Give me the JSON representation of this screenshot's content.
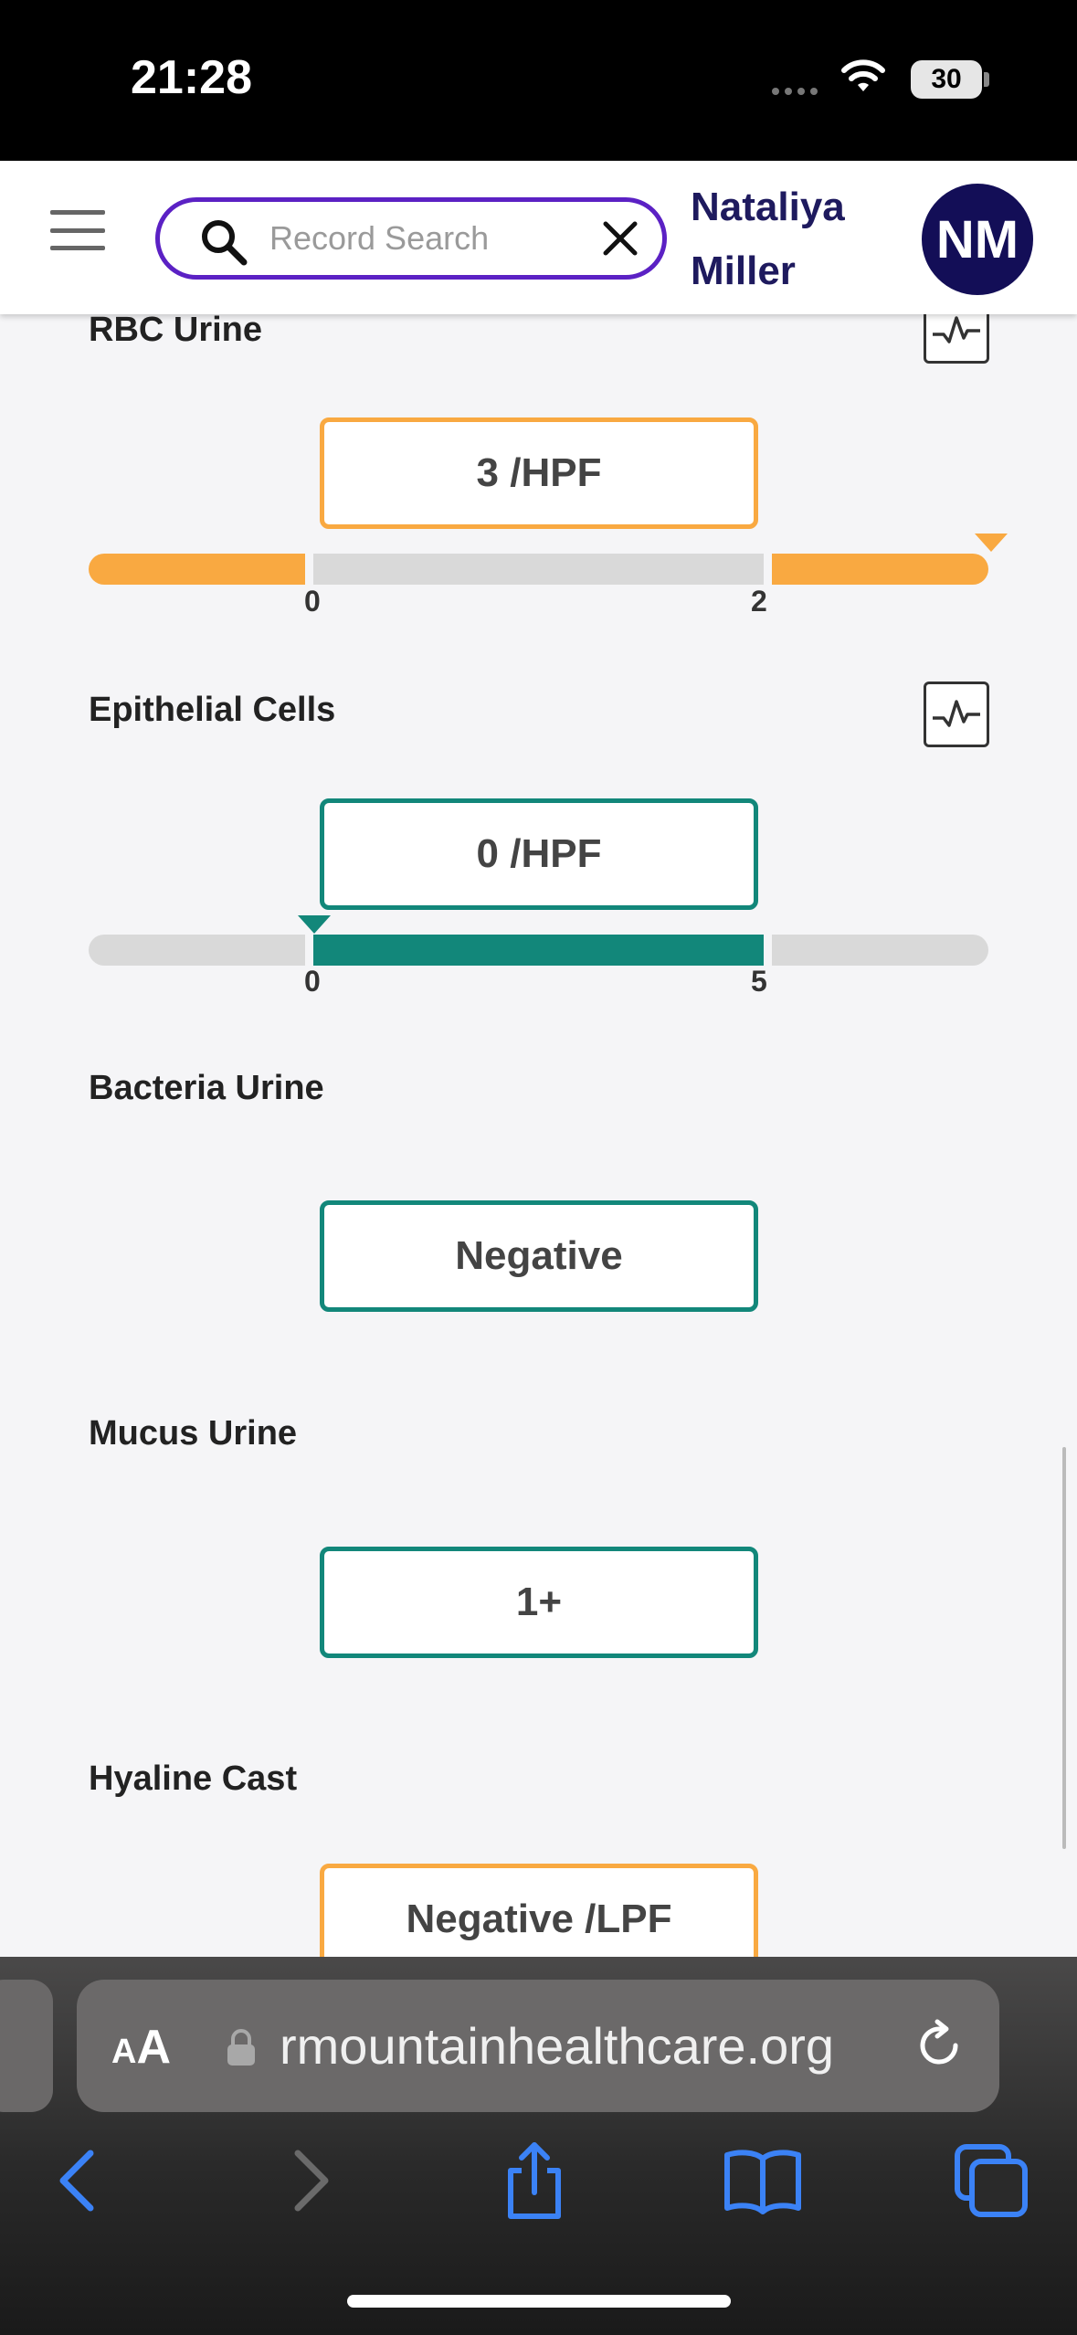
{
  "status_bar": {
    "time": "21:28",
    "battery": "30"
  },
  "header": {
    "search": {
      "placeholder": "Record Search",
      "value": ""
    },
    "user": {
      "first_name": "Nataliya",
      "last_name": "Miller",
      "initials": "NM"
    }
  },
  "results": [
    {
      "name": "RBC Urine",
      "value": "3 /HPF",
      "status": "abnormal",
      "range": {
        "low": "0",
        "high": "2"
      }
    },
    {
      "name": "Epithelial Cells",
      "value": "0 /HPF",
      "status": "normal",
      "range": {
        "low": "0",
        "high": "5"
      }
    },
    {
      "name": "Bacteria Urine",
      "value": "Negative",
      "status": "normal"
    },
    {
      "name": "Mucus Urine",
      "value": "1+",
      "status": "normal"
    },
    {
      "name": "Hyaline Cast",
      "value": "Negative /LPF",
      "status": "abnormal"
    }
  ],
  "browser": {
    "text_size_label_small": "A",
    "text_size_label_big": "A",
    "url": "rmountainhealthcare.org"
  },
  "colors": {
    "brand_purple": "#5b21c4",
    "navy": "#130e57",
    "abnormal_orange": "#f9a941",
    "normal_teal": "#12877a",
    "range_gray": "#d9d9d9"
  }
}
